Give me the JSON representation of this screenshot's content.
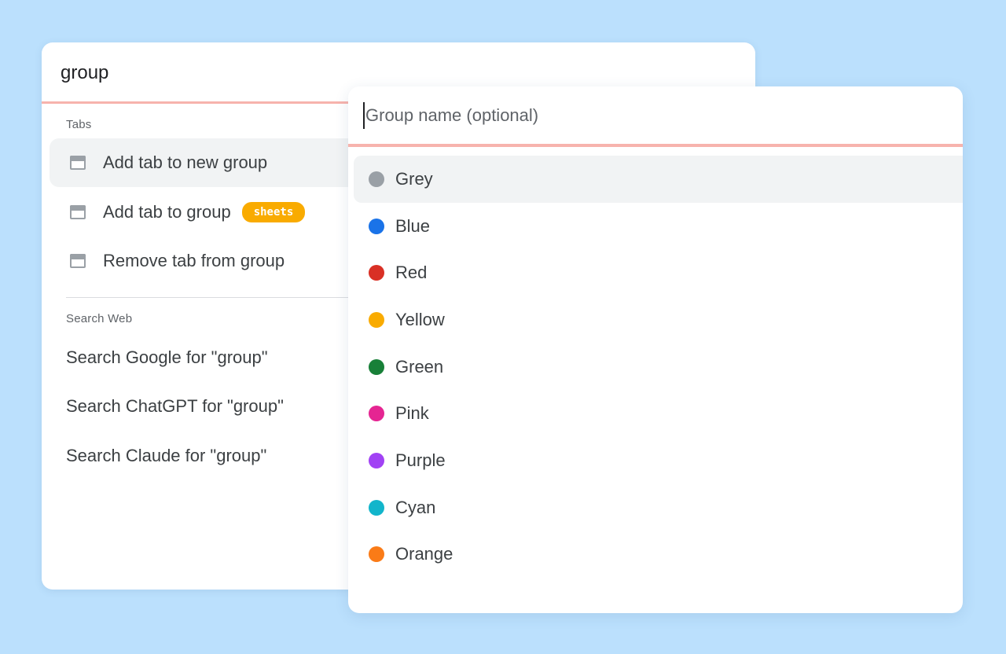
{
  "palette": {
    "query": "group",
    "tabs_header": "Tabs",
    "commands": [
      {
        "label": "Add tab to new group",
        "icon": "tab-icon",
        "active": true
      },
      {
        "label": "Add tab to group",
        "icon": "tab-icon",
        "badge": "sheets"
      },
      {
        "label": "Remove tab from group",
        "icon": "tab-icon"
      }
    ],
    "web_header": "Search Web",
    "web_searches": [
      {
        "label": "Search Google for \"group\""
      },
      {
        "label": "Search ChatGPT for \"group\""
      },
      {
        "label": "Search Claude for \"group\""
      }
    ]
  },
  "group_dialog": {
    "name_placeholder": "Group name (optional)",
    "colors": [
      {
        "label": "Grey",
        "hex": "#9aa0a6",
        "active": true
      },
      {
        "label": "Blue",
        "hex": "#1a73e8"
      },
      {
        "label": "Red",
        "hex": "#d93025"
      },
      {
        "label": "Yellow",
        "hex": "#f9ab00"
      },
      {
        "label": "Green",
        "hex": "#188038"
      },
      {
        "label": "Pink",
        "hex": "#e52592"
      },
      {
        "label": "Purple",
        "hex": "#a142f4"
      },
      {
        "label": "Cyan",
        "hex": "#12b5cb"
      },
      {
        "label": "Orange",
        "hex": "#fa7b17"
      }
    ]
  },
  "colors": {
    "background": "#bbe0fd",
    "divider_accent": "#f7b3ad",
    "badge": "#f9ab00",
    "active_row": "#f1f3f4"
  }
}
